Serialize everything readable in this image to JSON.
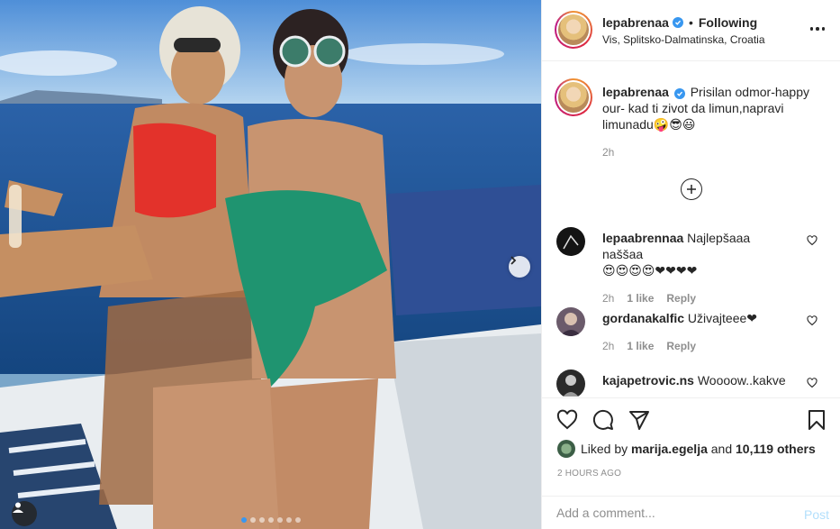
{
  "post": {
    "author": "lepabrenaa",
    "following_label": "Following",
    "bullet": "•",
    "location": "Vis, Splitsko-Dalmatinska, Croatia",
    "carousel_total_slides": 7,
    "carousel_active_slide": 1
  },
  "caption": {
    "username": "lepabrenaa",
    "text": "Prisilan odmor-happy our- kad ti zivot da limun,napravi limunadu🤪😎😃",
    "time": "2h"
  },
  "comments": [
    {
      "username": "lepaabrennaa",
      "text": "Najlepšaaa naššaa",
      "emoji": "😍😍😍😍❤❤❤❤",
      "time": "2h",
      "likes": "1 like",
      "reply": "Reply"
    },
    {
      "username": "gordanakalfic",
      "text": "Uživajteee❤",
      "emoji": "",
      "time": "2h",
      "likes": "1 like",
      "reply": "Reply"
    },
    {
      "username": "kajapetrovic.ns",
      "text": "Woooow..kakve",
      "emoji": "",
      "time": "",
      "likes": "",
      "reply": ""
    }
  ],
  "likes": {
    "prefix": "Liked by",
    "user": "marija.egelja",
    "joiner": "and",
    "others": "10,119 others"
  },
  "timestamp": "2 HOURS AGO",
  "add_comment": {
    "placeholder": "Add a comment...",
    "post_label": "Post"
  },
  "icons": [
    "heart-icon",
    "comment-icon",
    "share-icon",
    "bookmark-icon",
    "more-icon",
    "chevron-right-icon",
    "plus-circle-icon",
    "tag-user-icon",
    "verified-icon"
  ],
  "colors": {
    "accent": "#3897f0",
    "text": "#262626",
    "muted": "#8e8e8e",
    "post_disabled": "#b2dffc"
  }
}
